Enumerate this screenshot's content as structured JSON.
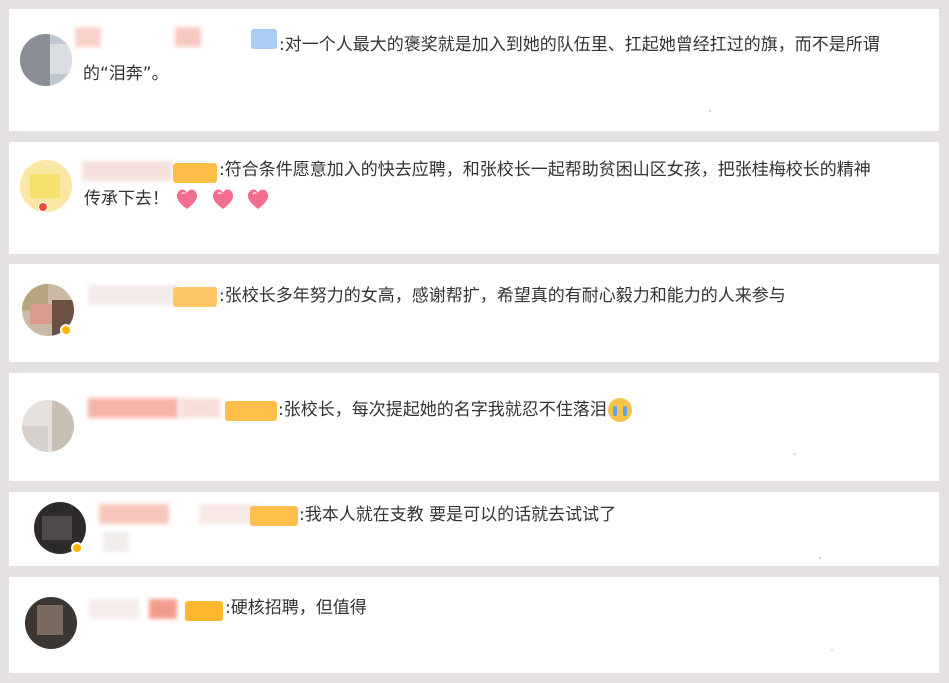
{
  "comments": [
    {
      "line1": ":对一个人最大的褒奖就是加入到她的队伍里、扛起她曾经扛过的旗，而不是所谓",
      "line2": "的“泪奔”。",
      "hearts": 0,
      "cry": false
    },
    {
      "line1": ":符合条件愿意加入的快去应聘，和张校长一起帮助贫困山区女孩，把张桂梅校长的精神",
      "line2": "传承下去！",
      "hearts": 3,
      "cry": false
    },
    {
      "line1": ":张校长多年努力的女高，感谢帮扩，希望真的有耐心毅力和能力的人来参与",
      "line2": "",
      "hearts": 0,
      "cry": false
    },
    {
      "line1": ":张校长，每次提起她的名字我就忍不住落泪",
      "line2": "",
      "hearts": 0,
      "cry": true
    },
    {
      "line1": ":我本人就在支教 要是可以的话就去试试了",
      "line2": "",
      "hearts": 0,
      "cry": false
    },
    {
      "line1": ":硬核招聘，但值得",
      "line2": "",
      "hearts": 0,
      "cry": false
    }
  ],
  "emoji": {
    "heart": "heart-emoji",
    "cry": "crying-emoji"
  },
  "colors": {
    "background": "#e6e1e1",
    "card": "#ffffff",
    "text": "#333333",
    "badge": "#ffb400"
  }
}
